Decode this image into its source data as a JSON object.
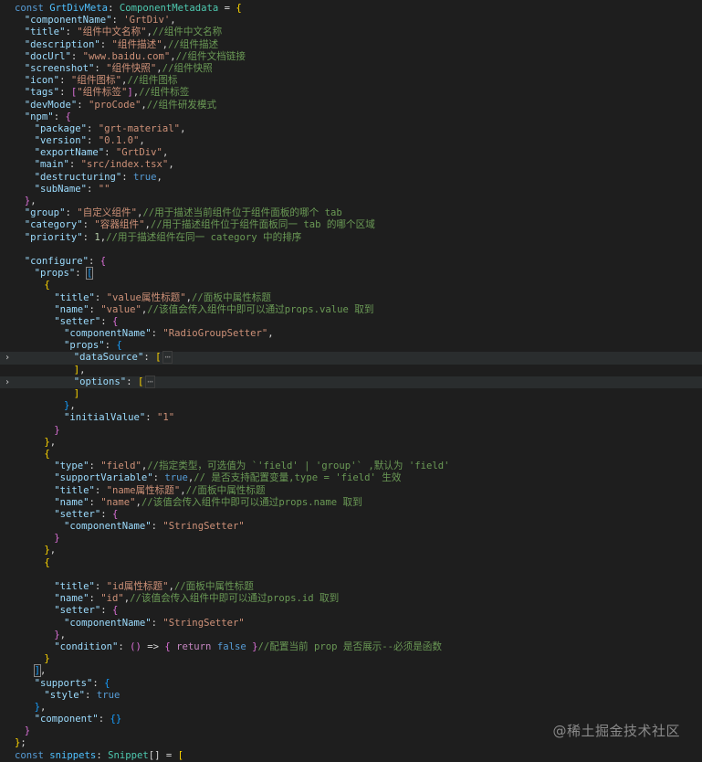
{
  "editor": {
    "lines": [
      {
        "indent": 0,
        "tokens": [
          [
            "kw",
            "const "
          ],
          [
            "var",
            "GrtDivMeta"
          ],
          [
            "punc",
            ": "
          ],
          [
            "type",
            "ComponentMetadata"
          ],
          [
            "punc",
            " = "
          ],
          [
            "b1",
            "{"
          ]
        ]
      },
      {
        "indent": 1,
        "tokens": [
          [
            "key",
            "\"componentName\""
          ],
          [
            "punc",
            ": "
          ],
          [
            "str",
            "'GrtDiv'"
          ],
          [
            "punc",
            ","
          ]
        ]
      },
      {
        "indent": 1,
        "tokens": [
          [
            "key",
            "\"title\""
          ],
          [
            "punc",
            ": "
          ],
          [
            "str",
            "\"组件中文名称\""
          ],
          [
            "punc",
            ","
          ],
          [
            "cmt",
            "//组件中文名称"
          ]
        ]
      },
      {
        "indent": 1,
        "tokens": [
          [
            "key",
            "\"description\""
          ],
          [
            "punc",
            ": "
          ],
          [
            "str",
            "\"组件描述\""
          ],
          [
            "punc",
            ","
          ],
          [
            "cmt",
            "//组件描述"
          ]
        ]
      },
      {
        "indent": 1,
        "tokens": [
          [
            "key",
            "\"docUrl\""
          ],
          [
            "punc",
            ": "
          ],
          [
            "str",
            "\"www.baidu.com\""
          ],
          [
            "punc",
            ","
          ],
          [
            "cmt",
            "//组件文档链接"
          ]
        ]
      },
      {
        "indent": 1,
        "tokens": [
          [
            "key",
            "\"screenshot\""
          ],
          [
            "punc",
            ": "
          ],
          [
            "str",
            "\"组件快照\""
          ],
          [
            "punc",
            ","
          ],
          [
            "cmt",
            "//组件快照"
          ]
        ]
      },
      {
        "indent": 1,
        "tokens": [
          [
            "key",
            "\"icon\""
          ],
          [
            "punc",
            ": "
          ],
          [
            "str",
            "\"组件图标\""
          ],
          [
            "punc",
            ","
          ],
          [
            "cmt",
            "//组件图标"
          ]
        ]
      },
      {
        "indent": 1,
        "tokens": [
          [
            "key",
            "\"tags\""
          ],
          [
            "punc",
            ": "
          ],
          [
            "b2",
            "["
          ],
          [
            "str",
            "\"组件标签\""
          ],
          [
            "b2",
            "]"
          ],
          [
            "punc",
            ","
          ],
          [
            "cmt",
            "//组件标签"
          ]
        ]
      },
      {
        "indent": 1,
        "tokens": [
          [
            "key",
            "\"devMode\""
          ],
          [
            "punc",
            ": "
          ],
          [
            "str",
            "\"proCode\""
          ],
          [
            "punc",
            ","
          ],
          [
            "cmt",
            "//组件研发模式"
          ]
        ]
      },
      {
        "indent": 1,
        "tokens": [
          [
            "key",
            "\"npm\""
          ],
          [
            "punc",
            ": "
          ],
          [
            "b2",
            "{"
          ]
        ]
      },
      {
        "indent": 2,
        "tokens": [
          [
            "key",
            "\"package\""
          ],
          [
            "punc",
            ": "
          ],
          [
            "str",
            "\"grt-material\""
          ],
          [
            "punc",
            ","
          ]
        ]
      },
      {
        "indent": 2,
        "tokens": [
          [
            "key",
            "\"version\""
          ],
          [
            "punc",
            ": "
          ],
          [
            "str",
            "\"0.1.0\""
          ],
          [
            "punc",
            ","
          ]
        ]
      },
      {
        "indent": 2,
        "tokens": [
          [
            "key",
            "\"exportName\""
          ],
          [
            "punc",
            ": "
          ],
          [
            "str",
            "\"GrtDiv\""
          ],
          [
            "punc",
            ","
          ]
        ]
      },
      {
        "indent": 2,
        "tokens": [
          [
            "key",
            "\"main\""
          ],
          [
            "punc",
            ": "
          ],
          [
            "str",
            "\"src/index.tsx\""
          ],
          [
            "punc",
            ","
          ]
        ]
      },
      {
        "indent": 2,
        "tokens": [
          [
            "key",
            "\"destructuring\""
          ],
          [
            "punc",
            ": "
          ],
          [
            "bool",
            "true"
          ],
          [
            "punc",
            ","
          ]
        ]
      },
      {
        "indent": 2,
        "tokens": [
          [
            "key",
            "\"subName\""
          ],
          [
            "punc",
            ": "
          ],
          [
            "str",
            "\"\""
          ]
        ]
      },
      {
        "indent": 1,
        "tokens": [
          [
            "b2",
            "}"
          ],
          [
            "punc",
            ","
          ]
        ]
      },
      {
        "indent": 1,
        "tokens": [
          [
            "key",
            "\"group\""
          ],
          [
            "punc",
            ": "
          ],
          [
            "str",
            "\"自定义组件\""
          ],
          [
            "punc",
            ","
          ],
          [
            "cmt",
            "//用于描述当前组件位于组件面板的哪个 tab"
          ]
        ]
      },
      {
        "indent": 1,
        "tokens": [
          [
            "key",
            "\"category\""
          ],
          [
            "punc",
            ": "
          ],
          [
            "str",
            "\"容器组件\""
          ],
          [
            "punc",
            ","
          ],
          [
            "cmt",
            "//用于描述组件位于组件面板同一 tab 的哪个区域"
          ]
        ]
      },
      {
        "indent": 1,
        "tokens": [
          [
            "key",
            "\"priority\""
          ],
          [
            "punc",
            ": "
          ],
          [
            "num",
            "1"
          ],
          [
            "punc",
            ","
          ],
          [
            "cmt",
            "//用于描述组件在同一 category 中的排序"
          ]
        ]
      },
      {
        "indent": 1,
        "tokens": []
      },
      {
        "indent": 1,
        "tokens": [
          [
            "key",
            "\"configure\""
          ],
          [
            "punc",
            ": "
          ],
          [
            "b2",
            "{"
          ]
        ]
      },
      {
        "indent": 2,
        "tokens": [
          [
            "key",
            "\"props\""
          ],
          [
            "punc",
            ": "
          ],
          [
            "b3m",
            "["
          ]
        ]
      },
      {
        "indent": 3,
        "tokens": [
          [
            "b1",
            "{"
          ]
        ]
      },
      {
        "indent": 4,
        "tokens": [
          [
            "key",
            "\"title\""
          ],
          [
            "punc",
            ": "
          ],
          [
            "str",
            "\"value属性标题\""
          ],
          [
            "punc",
            ","
          ],
          [
            "cmt",
            "//面板中属性标题"
          ]
        ]
      },
      {
        "indent": 4,
        "tokens": [
          [
            "key",
            "\"name\""
          ],
          [
            "punc",
            ": "
          ],
          [
            "str",
            "\"value\""
          ],
          [
            "punc",
            ","
          ],
          [
            "cmt",
            "//该值会传入组件中即可以通过props.value 取到"
          ]
        ]
      },
      {
        "indent": 4,
        "tokens": [
          [
            "key",
            "\"setter\""
          ],
          [
            "punc",
            ": "
          ],
          [
            "b2",
            "{"
          ]
        ]
      },
      {
        "indent": 5,
        "tokens": [
          [
            "key",
            "\"componentName\""
          ],
          [
            "punc",
            ": "
          ],
          [
            "str",
            "\"RadioGroupSetter\""
          ],
          [
            "punc",
            ","
          ]
        ]
      },
      {
        "indent": 5,
        "tokens": [
          [
            "key",
            "\"props\""
          ],
          [
            "punc",
            ": "
          ],
          [
            "b3",
            "{"
          ]
        ]
      },
      {
        "indent": 6,
        "folded": true,
        "tokens": [
          [
            "key",
            "\"dataSource\""
          ],
          [
            "punc",
            ": "
          ],
          [
            "b1",
            "["
          ],
          [
            "fold",
            "⋯"
          ]
        ]
      },
      {
        "indent": 6,
        "tokens": [
          [
            "b1",
            "]"
          ],
          [
            "punc",
            ","
          ]
        ]
      },
      {
        "indent": 6,
        "folded": true,
        "tokens": [
          [
            "key",
            "\"options\""
          ],
          [
            "punc",
            ": "
          ],
          [
            "b1",
            "["
          ],
          [
            "fold",
            "⋯"
          ]
        ]
      },
      {
        "indent": 6,
        "tokens": [
          [
            "b1",
            "]"
          ]
        ]
      },
      {
        "indent": 5,
        "tokens": [
          [
            "b3",
            "}"
          ],
          [
            "punc",
            ","
          ]
        ]
      },
      {
        "indent": 5,
        "tokens": [
          [
            "key",
            "\"initialValue\""
          ],
          [
            "punc",
            ": "
          ],
          [
            "str",
            "\"1\""
          ]
        ]
      },
      {
        "indent": 4,
        "tokens": [
          [
            "b2",
            "}"
          ]
        ]
      },
      {
        "indent": 3,
        "tokens": [
          [
            "b1",
            "}"
          ],
          [
            "punc",
            ","
          ]
        ]
      },
      {
        "indent": 3,
        "tokens": [
          [
            "b1",
            "{"
          ]
        ]
      },
      {
        "indent": 4,
        "tokens": [
          [
            "key",
            "\"type\""
          ],
          [
            "punc",
            ": "
          ],
          [
            "str",
            "\"field\""
          ],
          [
            "punc",
            ","
          ],
          [
            "cmt",
            "//指定类型，可选值为 `'field' | 'group'` ,默认为 'field'"
          ]
        ]
      },
      {
        "indent": 4,
        "tokens": [
          [
            "key",
            "\"supportVariable\""
          ],
          [
            "punc",
            ": "
          ],
          [
            "bool",
            "true"
          ],
          [
            "punc",
            ","
          ],
          [
            "cmt",
            "// 是否支持配置变量,type = 'field' 生效"
          ]
        ]
      },
      {
        "indent": 4,
        "tokens": [
          [
            "key",
            "\"title\""
          ],
          [
            "punc",
            ": "
          ],
          [
            "str",
            "\"name属性标题\""
          ],
          [
            "punc",
            ","
          ],
          [
            "cmt",
            "//面板中属性标题"
          ]
        ]
      },
      {
        "indent": 4,
        "tokens": [
          [
            "key",
            "\"name\""
          ],
          [
            "punc",
            ": "
          ],
          [
            "str",
            "\"name\""
          ],
          [
            "punc",
            ","
          ],
          [
            "cmt",
            "//该值会传入组件中即可以通过props.name 取到"
          ]
        ]
      },
      {
        "indent": 4,
        "tokens": [
          [
            "key",
            "\"setter\""
          ],
          [
            "punc",
            ": "
          ],
          [
            "b2",
            "{"
          ]
        ]
      },
      {
        "indent": 5,
        "tokens": [
          [
            "key",
            "\"componentName\""
          ],
          [
            "punc",
            ": "
          ],
          [
            "str",
            "\"StringSetter\""
          ]
        ]
      },
      {
        "indent": 4,
        "tokens": [
          [
            "b2",
            "}"
          ]
        ]
      },
      {
        "indent": 3,
        "tokens": [
          [
            "b1",
            "}"
          ],
          [
            "punc",
            ","
          ]
        ]
      },
      {
        "indent": 3,
        "tokens": [
          [
            "b1",
            "{"
          ]
        ]
      },
      {
        "indent": 4,
        "tokens": []
      },
      {
        "indent": 4,
        "tokens": [
          [
            "key",
            "\"title\""
          ],
          [
            "punc",
            ": "
          ],
          [
            "str",
            "\"id属性标题\""
          ],
          [
            "punc",
            ","
          ],
          [
            "cmt",
            "//面板中属性标题"
          ]
        ]
      },
      {
        "indent": 4,
        "tokens": [
          [
            "key",
            "\"name\""
          ],
          [
            "punc",
            ": "
          ],
          [
            "str",
            "\"id\""
          ],
          [
            "punc",
            ","
          ],
          [
            "cmt",
            "//该值会传入组件中即可以通过props.id 取到"
          ]
        ]
      },
      {
        "indent": 4,
        "tokens": [
          [
            "key",
            "\"setter\""
          ],
          [
            "punc",
            ": "
          ],
          [
            "b2",
            "{"
          ]
        ]
      },
      {
        "indent": 5,
        "tokens": [
          [
            "key",
            "\"componentName\""
          ],
          [
            "punc",
            ": "
          ],
          [
            "str",
            "\"StringSetter\""
          ]
        ]
      },
      {
        "indent": 4,
        "tokens": [
          [
            "b2",
            "}"
          ],
          [
            "punc",
            ","
          ]
        ]
      },
      {
        "indent": 4,
        "tokens": [
          [
            "key",
            "\"condition\""
          ],
          [
            "punc",
            ": "
          ],
          [
            "b2",
            "()"
          ],
          [
            "punc",
            " => "
          ],
          [
            "b2",
            "{ "
          ],
          [
            "ctrl",
            "return "
          ],
          [
            "bool",
            "false "
          ],
          [
            "b2",
            "}"
          ],
          [
            "cmt",
            "//配置当前 prop 是否展示--必须是函数"
          ]
        ]
      },
      {
        "indent": 3,
        "tokens": [
          [
            "b1",
            "}"
          ]
        ]
      },
      {
        "indent": 2,
        "tokens": [
          [
            "b3m",
            "]"
          ],
          [
            "punc",
            ","
          ]
        ]
      },
      {
        "indent": 2,
        "tokens": [
          [
            "key",
            "\"supports\""
          ],
          [
            "punc",
            ": "
          ],
          [
            "b3",
            "{"
          ]
        ]
      },
      {
        "indent": 3,
        "tokens": [
          [
            "key",
            "\"style\""
          ],
          [
            "punc",
            ": "
          ],
          [
            "bool",
            "true"
          ]
        ]
      },
      {
        "indent": 2,
        "tokens": [
          [
            "b3",
            "}"
          ],
          [
            "punc",
            ","
          ]
        ]
      },
      {
        "indent": 2,
        "tokens": [
          [
            "key",
            "\"component\""
          ],
          [
            "punc",
            ": "
          ],
          [
            "b3",
            "{}"
          ]
        ]
      },
      {
        "indent": 1,
        "tokens": [
          [
            "b2",
            "}"
          ]
        ]
      },
      {
        "indent": 0,
        "tokens": [
          [
            "b1",
            "}"
          ],
          [
            "punc",
            ";"
          ]
        ]
      },
      {
        "indent": 0,
        "tokens": [
          [
            "kw",
            "const "
          ],
          [
            "var",
            "snippets"
          ],
          [
            "punc",
            ": "
          ],
          [
            "type",
            "Snippet"
          ],
          [
            "punc",
            "[] = "
          ],
          [
            "b1",
            "["
          ]
        ]
      }
    ],
    "fold_icon": "chevron-right-icon"
  },
  "watermark": "@稀土掘金技术社区"
}
